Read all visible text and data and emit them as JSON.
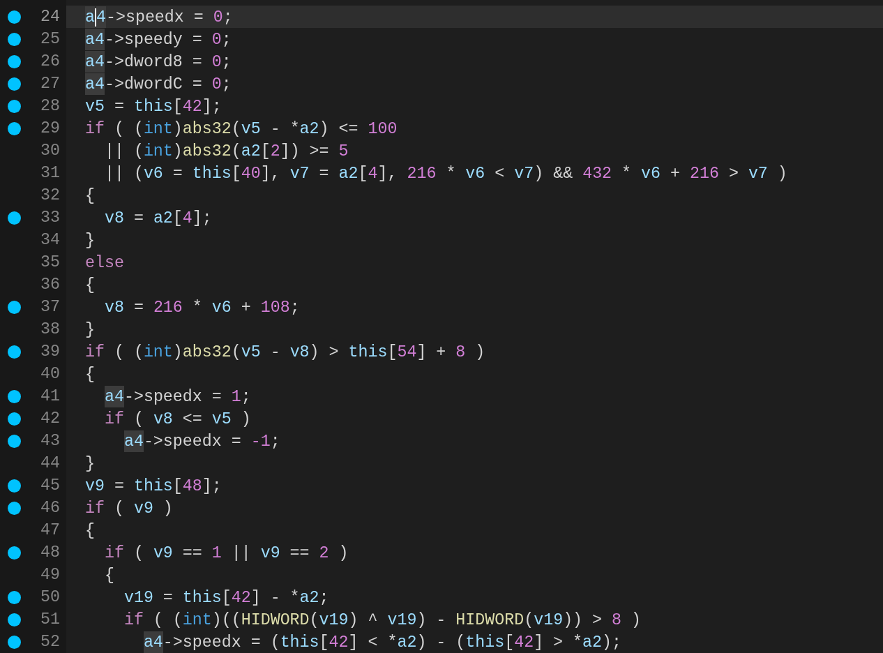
{
  "editor": {
    "lines": [
      {
        "number": "24",
        "breakpoint": true,
        "current": true,
        "tokens": [
          {
            "text": "a",
            "kind": "match"
          },
          {
            "kind": "cursor"
          },
          {
            "text": "4",
            "kind": "match"
          },
          {
            "text": "->speedx = ",
            "kind": "plain"
          },
          {
            "text": "0",
            "kind": "number"
          },
          {
            "text": ";",
            "kind": "plain"
          }
        ]
      },
      {
        "number": "25",
        "breakpoint": true,
        "current": false,
        "tokens": [
          {
            "text": "a4",
            "kind": "match"
          },
          {
            "text": "->speedy = ",
            "kind": "plain"
          },
          {
            "text": "0",
            "kind": "number"
          },
          {
            "text": ";",
            "kind": "plain"
          }
        ]
      },
      {
        "number": "26",
        "breakpoint": true,
        "current": false,
        "tokens": [
          {
            "text": "a4",
            "kind": "match"
          },
          {
            "text": "->dword8 = ",
            "kind": "plain"
          },
          {
            "text": "0",
            "kind": "number"
          },
          {
            "text": ";",
            "kind": "plain"
          }
        ]
      },
      {
        "number": "27",
        "breakpoint": true,
        "current": false,
        "tokens": [
          {
            "text": "a4",
            "kind": "match"
          },
          {
            "text": "->dwordC = ",
            "kind": "plain"
          },
          {
            "text": "0",
            "kind": "number"
          },
          {
            "text": ";",
            "kind": "plain"
          }
        ]
      },
      {
        "number": "28",
        "breakpoint": true,
        "current": false,
        "tokens": [
          {
            "text": "v5",
            "kind": "variable"
          },
          {
            "text": " = ",
            "kind": "plain"
          },
          {
            "text": "this",
            "kind": "variable"
          },
          {
            "text": "[",
            "kind": "plain"
          },
          {
            "text": "42",
            "kind": "number"
          },
          {
            "text": "];",
            "kind": "plain"
          }
        ]
      },
      {
        "number": "29",
        "breakpoint": true,
        "current": false,
        "tokens": [
          {
            "text": "if",
            "kind": "keyword"
          },
          {
            "text": " ( (",
            "kind": "plain"
          },
          {
            "text": "int",
            "kind": "type"
          },
          {
            "text": ")",
            "kind": "plain"
          },
          {
            "text": "abs32",
            "kind": "function"
          },
          {
            "text": "(",
            "kind": "plain"
          },
          {
            "text": "v5",
            "kind": "variable"
          },
          {
            "text": " - *",
            "kind": "plain"
          },
          {
            "text": "a2",
            "kind": "variable"
          },
          {
            "text": ") <= ",
            "kind": "plain"
          },
          {
            "text": "100",
            "kind": "number"
          }
        ]
      },
      {
        "number": "30",
        "breakpoint": false,
        "current": false,
        "tokens": [
          {
            "text": "  || (",
            "kind": "plain"
          },
          {
            "text": "int",
            "kind": "type"
          },
          {
            "text": ")",
            "kind": "plain"
          },
          {
            "text": "abs32",
            "kind": "function"
          },
          {
            "text": "(",
            "kind": "plain"
          },
          {
            "text": "a2",
            "kind": "variable"
          },
          {
            "text": "[",
            "kind": "plain"
          },
          {
            "text": "2",
            "kind": "number"
          },
          {
            "text": "]) >= ",
            "kind": "plain"
          },
          {
            "text": "5",
            "kind": "number"
          }
        ]
      },
      {
        "number": "31",
        "breakpoint": false,
        "current": false,
        "tokens": [
          {
            "text": "  || (",
            "kind": "plain"
          },
          {
            "text": "v6",
            "kind": "variable"
          },
          {
            "text": " = ",
            "kind": "plain"
          },
          {
            "text": "this",
            "kind": "variable"
          },
          {
            "text": "[",
            "kind": "plain"
          },
          {
            "text": "40",
            "kind": "number"
          },
          {
            "text": "], ",
            "kind": "plain"
          },
          {
            "text": "v7",
            "kind": "variable"
          },
          {
            "text": " = ",
            "kind": "plain"
          },
          {
            "text": "a2",
            "kind": "variable"
          },
          {
            "text": "[",
            "kind": "plain"
          },
          {
            "text": "4",
            "kind": "number"
          },
          {
            "text": "], ",
            "kind": "plain"
          },
          {
            "text": "216",
            "kind": "number"
          },
          {
            "text": " * ",
            "kind": "plain"
          },
          {
            "text": "v6",
            "kind": "variable"
          },
          {
            "text": " < ",
            "kind": "plain"
          },
          {
            "text": "v7",
            "kind": "variable"
          },
          {
            "text": ") && ",
            "kind": "plain"
          },
          {
            "text": "432",
            "kind": "number"
          },
          {
            "text": " * ",
            "kind": "plain"
          },
          {
            "text": "v6",
            "kind": "variable"
          },
          {
            "text": " + ",
            "kind": "plain"
          },
          {
            "text": "216",
            "kind": "number"
          },
          {
            "text": " > ",
            "kind": "plain"
          },
          {
            "text": "v7",
            "kind": "variable"
          },
          {
            "text": " )",
            "kind": "plain"
          }
        ]
      },
      {
        "number": "32",
        "breakpoint": false,
        "current": false,
        "tokens": [
          {
            "text": "{",
            "kind": "plain"
          }
        ]
      },
      {
        "number": "33",
        "breakpoint": true,
        "current": false,
        "tokens": [
          {
            "text": "  v8",
            "kind": "variable"
          },
          {
            "text": " = ",
            "kind": "plain"
          },
          {
            "text": "a2",
            "kind": "variable"
          },
          {
            "text": "[",
            "kind": "plain"
          },
          {
            "text": "4",
            "kind": "number"
          },
          {
            "text": "];",
            "kind": "plain"
          }
        ]
      },
      {
        "number": "34",
        "breakpoint": false,
        "current": false,
        "tokens": [
          {
            "text": "}",
            "kind": "plain"
          }
        ]
      },
      {
        "number": "35",
        "breakpoint": false,
        "current": false,
        "tokens": [
          {
            "text": "else",
            "kind": "keyword"
          }
        ]
      },
      {
        "number": "36",
        "breakpoint": false,
        "current": false,
        "tokens": [
          {
            "text": "{",
            "kind": "plain"
          }
        ]
      },
      {
        "number": "37",
        "breakpoint": true,
        "current": false,
        "tokens": [
          {
            "text": "  v8",
            "kind": "variable"
          },
          {
            "text": " = ",
            "kind": "plain"
          },
          {
            "text": "216",
            "kind": "number"
          },
          {
            "text": " * ",
            "kind": "plain"
          },
          {
            "text": "v6",
            "kind": "variable"
          },
          {
            "text": " + ",
            "kind": "plain"
          },
          {
            "text": "108",
            "kind": "number"
          },
          {
            "text": ";",
            "kind": "plain"
          }
        ]
      },
      {
        "number": "38",
        "breakpoint": false,
        "current": false,
        "tokens": [
          {
            "text": "}",
            "kind": "plain"
          }
        ]
      },
      {
        "number": "39",
        "breakpoint": true,
        "current": false,
        "tokens": [
          {
            "text": "if",
            "kind": "keyword"
          },
          {
            "text": " ( (",
            "kind": "plain"
          },
          {
            "text": "int",
            "kind": "type"
          },
          {
            "text": ")",
            "kind": "plain"
          },
          {
            "text": "abs32",
            "kind": "function"
          },
          {
            "text": "(",
            "kind": "plain"
          },
          {
            "text": "v5",
            "kind": "variable"
          },
          {
            "text": " - ",
            "kind": "plain"
          },
          {
            "text": "v8",
            "kind": "variable"
          },
          {
            "text": ") > ",
            "kind": "plain"
          },
          {
            "text": "this",
            "kind": "variable"
          },
          {
            "text": "[",
            "kind": "plain"
          },
          {
            "text": "54",
            "kind": "number"
          },
          {
            "text": "] + ",
            "kind": "plain"
          },
          {
            "text": "8",
            "kind": "number"
          },
          {
            "text": " )",
            "kind": "plain"
          }
        ]
      },
      {
        "number": "40",
        "breakpoint": false,
        "current": false,
        "tokens": [
          {
            "text": "{",
            "kind": "plain"
          }
        ]
      },
      {
        "number": "41",
        "breakpoint": true,
        "current": false,
        "tokens": [
          {
            "text": "  a4",
            "kind": "match"
          },
          {
            "text": "->speedx = ",
            "kind": "plain"
          },
          {
            "text": "1",
            "kind": "number"
          },
          {
            "text": ";",
            "kind": "plain"
          }
        ]
      },
      {
        "number": "42",
        "breakpoint": true,
        "current": false,
        "tokens": [
          {
            "text": "  if",
            "kind": "keyword"
          },
          {
            "text": " ( ",
            "kind": "plain"
          },
          {
            "text": "v8",
            "kind": "variable"
          },
          {
            "text": " <= ",
            "kind": "plain"
          },
          {
            "text": "v5",
            "kind": "variable"
          },
          {
            "text": " )",
            "kind": "plain"
          }
        ]
      },
      {
        "number": "43",
        "breakpoint": true,
        "current": false,
        "tokens": [
          {
            "text": "    a4",
            "kind": "match"
          },
          {
            "text": "->speedx = ",
            "kind": "plain"
          },
          {
            "text": "-1",
            "kind": "number"
          },
          {
            "text": ";",
            "kind": "plain"
          }
        ]
      },
      {
        "number": "44",
        "breakpoint": false,
        "current": false,
        "tokens": [
          {
            "text": "}",
            "kind": "plain"
          }
        ]
      },
      {
        "number": "45",
        "breakpoint": true,
        "current": false,
        "tokens": [
          {
            "text": "v9",
            "kind": "variable"
          },
          {
            "text": " = ",
            "kind": "plain"
          },
          {
            "text": "this",
            "kind": "variable"
          },
          {
            "text": "[",
            "kind": "plain"
          },
          {
            "text": "48",
            "kind": "number"
          },
          {
            "text": "];",
            "kind": "plain"
          }
        ]
      },
      {
        "number": "46",
        "breakpoint": true,
        "current": false,
        "tokens": [
          {
            "text": "if",
            "kind": "keyword"
          },
          {
            "text": " ( ",
            "kind": "plain"
          },
          {
            "text": "v9",
            "kind": "variable"
          },
          {
            "text": " )",
            "kind": "plain"
          }
        ]
      },
      {
        "number": "47",
        "breakpoint": false,
        "current": false,
        "tokens": [
          {
            "text": "{",
            "kind": "plain"
          }
        ]
      },
      {
        "number": "48",
        "breakpoint": true,
        "current": false,
        "tokens": [
          {
            "text": "  if",
            "kind": "keyword"
          },
          {
            "text": " ( ",
            "kind": "plain"
          },
          {
            "text": "v9",
            "kind": "variable"
          },
          {
            "text": " == ",
            "kind": "plain"
          },
          {
            "text": "1",
            "kind": "number"
          },
          {
            "text": " || ",
            "kind": "plain"
          },
          {
            "text": "v9",
            "kind": "variable"
          },
          {
            "text": " == ",
            "kind": "plain"
          },
          {
            "text": "2",
            "kind": "number"
          },
          {
            "text": " )",
            "kind": "plain"
          }
        ]
      },
      {
        "number": "49",
        "breakpoint": false,
        "current": false,
        "tokens": [
          {
            "text": "  {",
            "kind": "plain"
          }
        ]
      },
      {
        "number": "50",
        "breakpoint": true,
        "current": false,
        "tokens": [
          {
            "text": "    v19",
            "kind": "variable"
          },
          {
            "text": " = ",
            "kind": "plain"
          },
          {
            "text": "this",
            "kind": "variable"
          },
          {
            "text": "[",
            "kind": "plain"
          },
          {
            "text": "42",
            "kind": "number"
          },
          {
            "text": "] - *",
            "kind": "plain"
          },
          {
            "text": "a2",
            "kind": "variable"
          },
          {
            "text": ";",
            "kind": "plain"
          }
        ]
      },
      {
        "number": "51",
        "breakpoint": true,
        "current": false,
        "tokens": [
          {
            "text": "    if",
            "kind": "keyword"
          },
          {
            "text": " ( (",
            "kind": "plain"
          },
          {
            "text": "int",
            "kind": "type"
          },
          {
            "text": ")((",
            "kind": "plain"
          },
          {
            "text": "HIDWORD",
            "kind": "function"
          },
          {
            "text": "(",
            "kind": "plain"
          },
          {
            "text": "v19",
            "kind": "variable"
          },
          {
            "text": ") ^ ",
            "kind": "plain"
          },
          {
            "text": "v19",
            "kind": "variable"
          },
          {
            "text": ") - ",
            "kind": "plain"
          },
          {
            "text": "HIDWORD",
            "kind": "function"
          },
          {
            "text": "(",
            "kind": "plain"
          },
          {
            "text": "v19",
            "kind": "variable"
          },
          {
            "text": ")) > ",
            "kind": "plain"
          },
          {
            "text": "8",
            "kind": "number"
          },
          {
            "text": " )",
            "kind": "plain"
          }
        ]
      },
      {
        "number": "52",
        "breakpoint": true,
        "current": false,
        "tokens": [
          {
            "text": "      a4",
            "kind": "match"
          },
          {
            "text": "->speedx = (",
            "kind": "plain"
          },
          {
            "text": "this",
            "kind": "variable"
          },
          {
            "text": "[",
            "kind": "plain"
          },
          {
            "text": "42",
            "kind": "number"
          },
          {
            "text": "] < *",
            "kind": "plain"
          },
          {
            "text": "a2",
            "kind": "variable"
          },
          {
            "text": ") - (",
            "kind": "plain"
          },
          {
            "text": "this",
            "kind": "variable"
          },
          {
            "text": "[",
            "kind": "plain"
          },
          {
            "text": "42",
            "kind": "number"
          },
          {
            "text": "] > *",
            "kind": "plain"
          },
          {
            "text": "a2",
            "kind": "variable"
          },
          {
            "text": ");",
            "kind": "plain"
          }
        ]
      }
    ]
  }
}
